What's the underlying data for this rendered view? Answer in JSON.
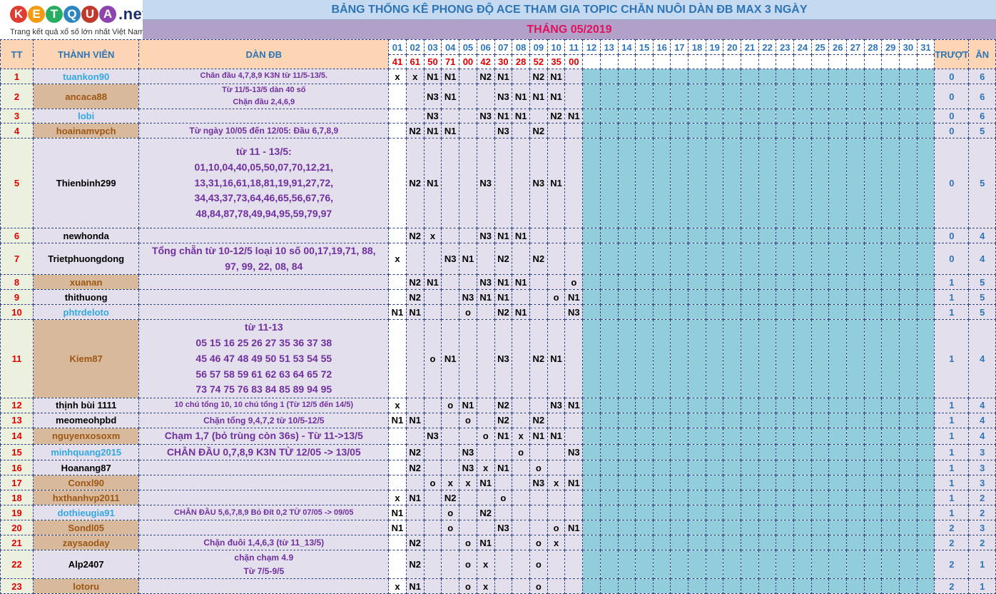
{
  "logo": {
    "letters": [
      {
        "ch": "K",
        "color": "#e03c31"
      },
      {
        "ch": "E",
        "color": "#f39c12"
      },
      {
        "ch": "T",
        "color": "#27ae60"
      },
      {
        "ch": "Q",
        "color": "#2e86c1"
      },
      {
        "ch": "U",
        "color": "#c0392b"
      },
      {
        "ch": "A",
        "color": "#8e44ad"
      }
    ],
    "suffix": ".net",
    "tagline": "Trang kết quả xổ số lớn nhất Việt Nam"
  },
  "title": "BẢNG THỐNG KÊ PHONG ĐỘ ACE THAM GIA TOPIC CHĂN NUÔI DÀN ĐB MAX 3 NGÀY",
  "month": "THÁNG 05/2019",
  "headers": {
    "stt": "TT",
    "member": "THÀNH VIÊN",
    "plan": "DÀN ĐB",
    "miss": "TRƯỢT",
    "win": "ĂN"
  },
  "days": [
    "01",
    "02",
    "03",
    "04",
    "05",
    "06",
    "07",
    "08",
    "09",
    "10",
    "11",
    "12",
    "13",
    "14",
    "15",
    "16",
    "17",
    "18",
    "19",
    "20",
    "21",
    "22",
    "23",
    "24",
    "25",
    "26",
    "27",
    "28",
    "29",
    "30",
    "31"
  ],
  "results": [
    "41",
    "61",
    "50",
    "71",
    "00",
    "42",
    "30",
    "28",
    "52",
    "35",
    "00",
    "",
    "",
    "",
    "",
    "",
    "",
    "",
    "",
    "",
    "",
    "",
    "",
    "",
    "",
    "",
    "",
    "",
    "",
    "",
    ""
  ],
  "colors": {
    "name_blue": "#31a9e0",
    "name_brown": "#9c5714",
    "name_black": "#000000",
    "day_blue": "#2e75b6",
    "red": "#e00000",
    "plan_purple": "#7030a0",
    "teal": "#92cddc"
  },
  "rows": [
    {
      "stt": "1",
      "name": "tuankon90",
      "color": "#31a9e0",
      "plan": [
        "Chăn đầu 4,7,8,9 K3N từ 11/5-13/5."
      ],
      "fs": 11,
      "marks": [
        "x",
        "x",
        "N1",
        "N1",
        "",
        "N2",
        "N1",
        "",
        "N2",
        "N1",
        ""
      ],
      "miss": "0",
      "win": "6"
    },
    {
      "stt": "2",
      "name": "ancaca88",
      "color": "#9c5714",
      "plan": [
        "Từ 11/5-13/5 dàn 40 số",
        "Chặn đầu 2,4,6,9"
      ],
      "fs": 11,
      "marks": [
        "",
        "",
        "N3",
        "N1",
        "",
        "",
        "N3",
        "N1",
        "N1",
        "N1",
        ""
      ],
      "miss": "0",
      "win": "6"
    },
    {
      "stt": "3",
      "name": "lobi",
      "color": "#31a9e0",
      "plan": [],
      "fs": 11,
      "marks": [
        "",
        "",
        "N3",
        "",
        "",
        "N3",
        "N1",
        "N1",
        "",
        "N2",
        "N1"
      ],
      "miss": "0",
      "win": "6"
    },
    {
      "stt": "4",
      "name": "hoainamvpch",
      "color": "#9c5714",
      "plan": [
        "Từ ngày 10/05 đến 12/05: Đầu 6,7,8,9"
      ],
      "fs": 12,
      "marks": [
        "",
        "N2",
        "N1",
        "N1",
        "",
        "",
        "N3",
        "",
        "N2",
        "",
        ""
      ],
      "miss": "0",
      "win": "5"
    },
    {
      "stt": "5",
      "name": "Thienbinh299",
      "color": "#000000",
      "plan": [
        "từ 11 - 13/5:",
        "01,10,04,40,05,50,07,70,12,21,",
        "13,31,16,61,18,81,19,91,27,72,",
        "34,43,37,73,64,46,65,56,67,76,",
        "48,84,87,78,49,94,95,59,79,97"
      ],
      "fs": 14,
      "marks": [
        "",
        "N2",
        "N1",
        "",
        "",
        "N3",
        "",
        "",
        "N3",
        "N1",
        ""
      ],
      "miss": "0",
      "win": "5"
    },
    {
      "stt": "6",
      "name": "newhonda",
      "color": "#000000",
      "plan": [],
      "fs": 11,
      "marks": [
        "",
        "N2",
        "x",
        "",
        "",
        "N3",
        "N1",
        "N1",
        "",
        "",
        ""
      ],
      "miss": "0",
      "win": "4"
    },
    {
      "stt": "7",
      "name": "Trietphuongdong",
      "color": "#000000",
      "plan": [
        "Tổng chẵn từ 10-12/5 loại 10 số 00,17,19,71, 88,",
        "97, 99, 22, 08, 84"
      ],
      "fs": 14,
      "marks": [
        "x",
        "",
        "",
        "N3",
        "N1",
        "",
        "N2",
        "",
        "N2",
        "",
        ""
      ],
      "miss": "0",
      "win": "4"
    },
    {
      "stt": "8",
      "name": "xuanan",
      "color": "#9c5714",
      "plan": [],
      "fs": 11,
      "marks": [
        "",
        "N2",
        "N1",
        "",
        "",
        "N3",
        "N1",
        "N1",
        "",
        "",
        "o"
      ],
      "miss": "1",
      "win": "5"
    },
    {
      "stt": "9",
      "name": "thithuong",
      "color": "#000000",
      "plan": [],
      "fs": 11,
      "marks": [
        "",
        "N2",
        "",
        "",
        "N3",
        "N1",
        "N1",
        "",
        "",
        "o",
        "N1"
      ],
      "miss": "1",
      "win": "5"
    },
    {
      "stt": "10",
      "name": "phtrdeloto",
      "color": "#31a9e0",
      "plan": [],
      "fs": 11,
      "marks": [
        "N1",
        "N1",
        "",
        "",
        "o",
        "",
        "N2",
        "N1",
        "",
        "",
        "N3"
      ],
      "miss": "1",
      "win": "5"
    },
    {
      "stt": "11",
      "name": "Kiem87",
      "color": "#9c5714",
      "plan": [
        "từ 11-13",
        "05 15 16 25 26 27 35 36 37 38",
        "45 46 47 48 49 50 51 53 54 55",
        "56 57 58 59 61 62 63 64 65 72",
        "73 74 75 76 83 84 85 89 94 95"
      ],
      "fs": 14,
      "marks": [
        "",
        "",
        "o",
        "N1",
        "",
        "",
        "N3",
        "",
        "N2",
        "N1",
        ""
      ],
      "miss": "1",
      "win": "4"
    },
    {
      "stt": "12",
      "name": "thịnh bùi 1111",
      "color": "#000000",
      "plan": [
        "10 chú tổng 10, 10 chú tổng 1 (Từ 12/5 đến 14/5)"
      ],
      "fs": 11,
      "marks": [
        "x",
        "",
        "",
        "o",
        "N1",
        "",
        "N2",
        "",
        "",
        "N3",
        "N1"
      ],
      "miss": "1",
      "win": "4"
    },
    {
      "stt": "13",
      "name": "meomeohpbd",
      "color": "#000000",
      "plan": [
        "Chặn tổng 9,4,7,2 từ 10/5-12/5"
      ],
      "fs": 12,
      "marks": [
        "N1",
        "N1",
        "",
        "",
        "o",
        "",
        "N2",
        "",
        "N2",
        "",
        ""
      ],
      "miss": "1",
      "win": "4"
    },
    {
      "stt": "14",
      "name": "nguyenxosoxm",
      "color": "#9c5714",
      "plan": [
        "Chạm 1,7 (bỏ trùng còn 36s) - Từ 11->13/5"
      ],
      "fs": 14,
      "marks": [
        "",
        "",
        "N3",
        "",
        "",
        "o",
        "N1",
        "x",
        "N1",
        "N1",
        ""
      ],
      "miss": "1",
      "win": "4"
    },
    {
      "stt": "15",
      "name": "minhquang2015",
      "color": "#31a9e0",
      "plan": [
        "CHẴN ĐẦU 0,7,8,9 K3N TỪ 12/05 -> 13/05"
      ],
      "fs": 14,
      "marks": [
        "",
        "N2",
        "",
        "",
        "N3",
        "",
        "",
        "o",
        "",
        "",
        "N3"
      ],
      "miss": "1",
      "win": "3"
    },
    {
      "stt": "16",
      "name": "Hoanang87",
      "color": "#000000",
      "plan": [],
      "fs": 11,
      "marks": [
        "",
        "N2",
        "",
        "",
        "N3",
        "x",
        "N1",
        "",
        "o",
        "",
        ""
      ],
      "miss": "1",
      "win": "3"
    },
    {
      "stt": "17",
      "name": "Conxl90",
      "color": "#9c5714",
      "plan": [],
      "fs": 11,
      "marks": [
        "",
        "",
        "o",
        "x",
        "x",
        "N1",
        "",
        "",
        "N3",
        "x",
        "N1"
      ],
      "miss": "1",
      "win": "3"
    },
    {
      "stt": "18",
      "name": "hxthanhvp2011",
      "color": "#9c5714",
      "plan": [],
      "fs": 11,
      "marks": [
        "x",
        "N1",
        "",
        "N2",
        "",
        "",
        "o",
        "",
        "",
        "",
        ""
      ],
      "miss": "1",
      "win": "2"
    },
    {
      "stt": "19",
      "name": "dothieugia91",
      "color": "#31a9e0",
      "plan": [
        "CHẴN ĐẦU 5,6,7,8,9 Bỏ Đít 0,2 TỪ 07/05 -> 09/05"
      ],
      "fs": 11,
      "marks": [
        "N1",
        "",
        "",
        "o",
        "",
        "N2",
        "",
        "",
        "",
        "",
        ""
      ],
      "miss": "1",
      "win": "2"
    },
    {
      "stt": "20",
      "name": "Sondl05",
      "color": "#9c5714",
      "plan": [],
      "fs": 11,
      "marks": [
        "N1",
        "",
        "",
        "o",
        "",
        "",
        "N3",
        "",
        "",
        "o",
        "N1"
      ],
      "miss": "2",
      "win": "3"
    },
    {
      "stt": "21",
      "name": "zaysaoday",
      "color": "#9c5714",
      "plan": [
        "Chặn đuôi 1,4,6,3 (từ 11_13/5)"
      ],
      "fs": 12,
      "marks": [
        "",
        "N2",
        "",
        "",
        "o",
        "N1",
        "",
        "",
        "o",
        "x",
        ""
      ],
      "miss": "2",
      "win": "2"
    },
    {
      "stt": "22",
      "name": "Alp2407",
      "color": "#000000",
      "plan": [
        "chặn chạm 4.9",
        "Từ 7/5-9/5"
      ],
      "fs": 12,
      "marks": [
        "",
        "N2",
        "",
        "",
        "o",
        "x",
        "",
        "",
        "o",
        "",
        ""
      ],
      "miss": "2",
      "win": "1"
    },
    {
      "stt": "23",
      "name": "lotoru",
      "color": "#9c5714",
      "plan": [],
      "fs": 11,
      "marks": [
        "x",
        "N1",
        "",
        "",
        "o",
        "x",
        "",
        "",
        "o",
        "",
        ""
      ],
      "miss": "2",
      "win": "1"
    }
  ]
}
